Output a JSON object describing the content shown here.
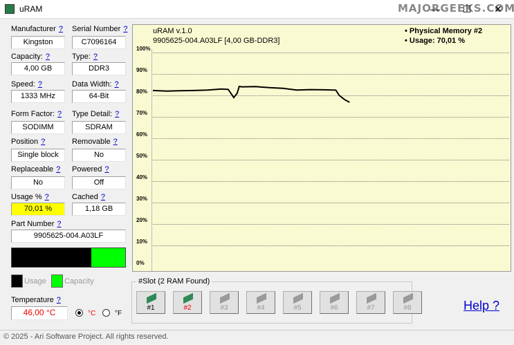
{
  "window": {
    "title": "uRAM",
    "watermark": "MAJORGEEKS.COM"
  },
  "fields": [
    {
      "label": "Manufacturer",
      "value": "Kingston"
    },
    {
      "label": "Serial Number",
      "value": "C7096164"
    },
    {
      "label": "Capacity:",
      "value": "4,00 GB"
    },
    {
      "label": "Type:",
      "value": "DDR3"
    },
    {
      "label": "Speed:",
      "value": "1333 MHz"
    },
    {
      "label": "Data Width:",
      "value": "64-Bit"
    },
    {
      "label": "Form Factor:",
      "value": "SODIMM"
    },
    {
      "label": "Type Detail:",
      "value": "SDRAM"
    },
    {
      "label": "Position",
      "value": "Single block"
    },
    {
      "label": "Removable",
      "value": "No"
    },
    {
      "label": "Replaceable",
      "value": "No"
    },
    {
      "label": "Powered",
      "value": "Off"
    },
    {
      "label": "Usage %",
      "value": "70,01 %"
    },
    {
      "label": "Cached",
      "value": "1,18 GB"
    }
  ],
  "help_mark": "?",
  "part_number": {
    "label": "Part Number",
    "value": "9905625-004.A03LF"
  },
  "usage_bar": {
    "usage_fraction": 0.7001,
    "usage_color": "#000000",
    "capacity_color": "#00ff00"
  },
  "legend": {
    "usage": "Usage",
    "capacity": "Capacity"
  },
  "temperature": {
    "label": "Temperature",
    "value": "46,00 °C",
    "unit_c": "°C",
    "unit_f": "°F",
    "selected": "C"
  },
  "chart_data": {
    "type": "line",
    "title": "uRAM v.1.0",
    "subtitle": "9905625-004.A03LF [4,00 GB-DDR3]",
    "legend": [
      "• Physical Memory #2",
      "• Usage: 70,01 %"
    ],
    "yticks": [
      "100%",
      "90%",
      "80%",
      "70%",
      "60%",
      "50%",
      "40%",
      "30%",
      "20%",
      "10%",
      "0%"
    ],
    "ylim": [
      0,
      100
    ],
    "x": [
      0,
      20,
      40,
      60,
      80,
      100,
      110,
      118,
      123,
      126,
      130,
      150,
      170,
      190,
      210,
      230,
      250,
      267,
      272,
      280,
      287
    ],
    "values": [
      82.3,
      82,
      82.2,
      82.3,
      82.5,
      83,
      82.8,
      79,
      81,
      84.2,
      84,
      84.1,
      83.6,
      83.3,
      82.5,
      82.7,
      82.6,
      82.5,
      80,
      78,
      76.8
    ],
    "xmax": 520
  },
  "slots": {
    "title": "#Slot (2 RAM Found)",
    "items": [
      {
        "label": "#1",
        "state": "present"
      },
      {
        "label": "#2",
        "state": "selected"
      },
      {
        "label": "#3",
        "state": "empty"
      },
      {
        "label": "#4",
        "state": "empty"
      },
      {
        "label": "#5",
        "state": "empty"
      },
      {
        "label": "#6",
        "state": "empty"
      },
      {
        "label": "#7",
        "state": "empty"
      },
      {
        "label": "#8",
        "state": "empty"
      }
    ]
  },
  "help_link": "Help ?",
  "footer": "© 2025 - Ari Software Project. All rights reserved."
}
